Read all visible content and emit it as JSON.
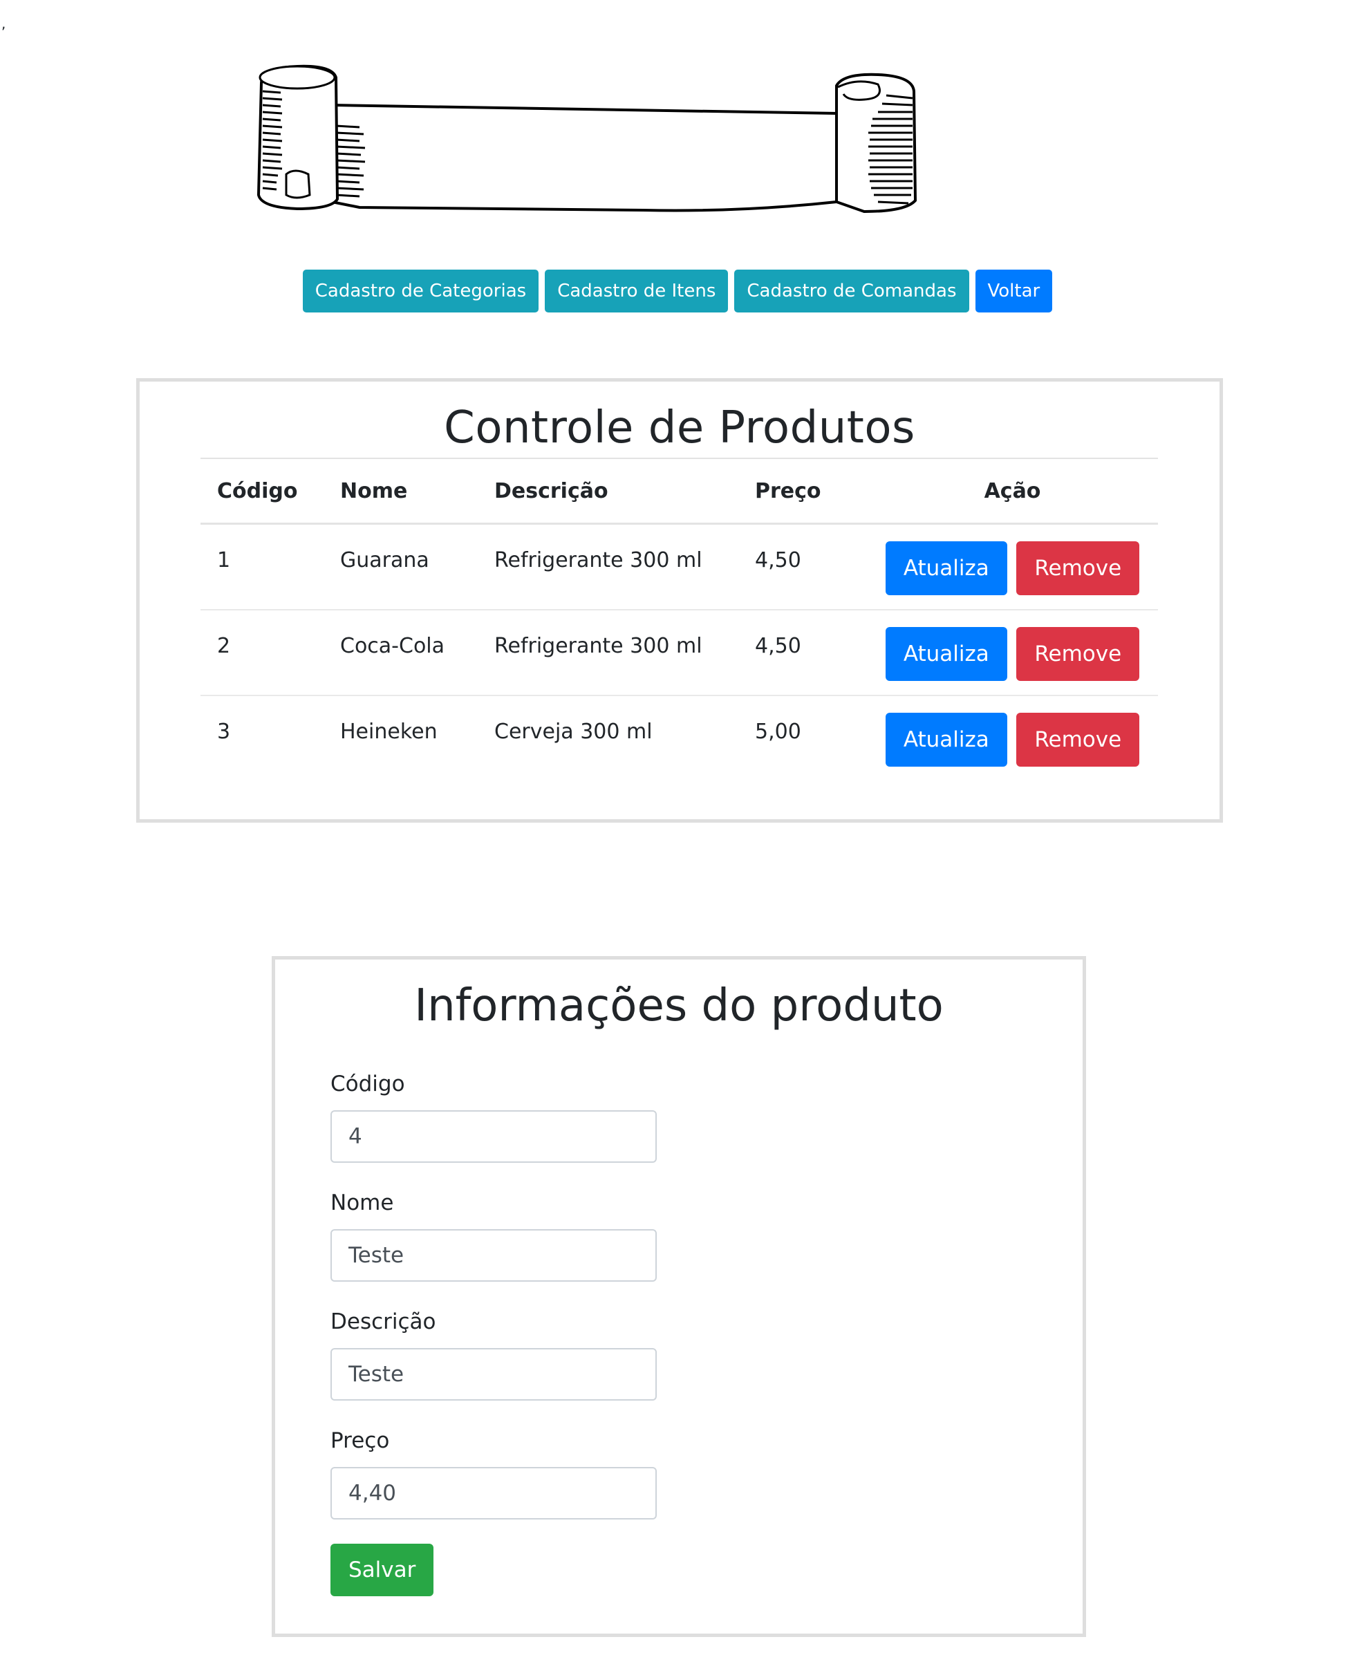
{
  "page": {
    "stray_mark": ","
  },
  "banner": {
    "icon": "ribbon-banner-icon"
  },
  "nav": {
    "items": [
      {
        "label": "Cadastro de Categorias",
        "color": "#17a2b8"
      },
      {
        "label": "Cadastro de Itens",
        "color": "#17a2b8"
      },
      {
        "label": "Cadastro de Comandas",
        "color": "#17a2b8"
      },
      {
        "label": "Voltar",
        "color": "#007bff"
      }
    ]
  },
  "products": {
    "title": "Controle de Produtos",
    "headers": {
      "codigo": "Código",
      "nome": "Nome",
      "descricao": "Descrição",
      "preco": "Preço",
      "acao": "Ação"
    },
    "rows": [
      {
        "codigo": "1",
        "nome": "Guarana",
        "descricao": "Refrigerante 300 ml",
        "preco": "4,50",
        "update_label": "Atualiza",
        "remove_label": "Remove"
      },
      {
        "codigo": "2",
        "nome": "Coca-Cola",
        "descricao": "Refrigerante 300 ml",
        "preco": "4,50",
        "update_label": "Atualiza",
        "remove_label": "Remove"
      },
      {
        "codigo": "3",
        "nome": "Heineken",
        "descricao": "Cerveja 300 ml",
        "preco": "5,00",
        "update_label": "Atualiza",
        "remove_label": "Remove"
      }
    ],
    "colors": {
      "update": "#007bff",
      "remove": "#dc3545"
    }
  },
  "form": {
    "title": "Informações do produto",
    "fields": {
      "codigo": {
        "label": "Código",
        "value": "4"
      },
      "nome": {
        "label": "Nome",
        "value": "Teste"
      },
      "descricao": {
        "label": "Descrição",
        "value": "Teste"
      },
      "preco": {
        "label": "Preço",
        "value": "4,40"
      }
    },
    "save_label": "Salvar",
    "save_color": "#28a745"
  }
}
